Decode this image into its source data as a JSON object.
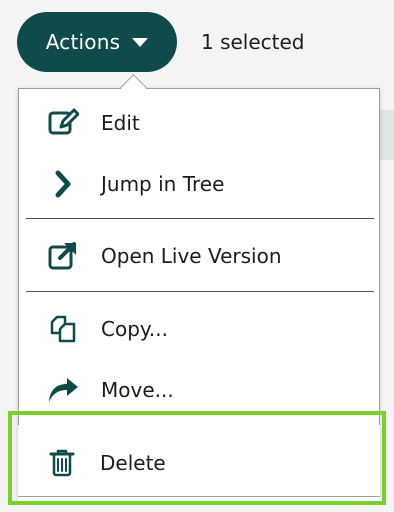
{
  "toolbar": {
    "actions_label": "Actions",
    "selection_count": "1 selected"
  },
  "menu": {
    "items": [
      {
        "label": "Edit",
        "icon": "edit-icon"
      },
      {
        "label": "Jump in Tree",
        "icon": "chevron-right-icon"
      },
      {
        "label": "Open Live Version",
        "icon": "external-link-icon"
      },
      {
        "label": "Copy...",
        "icon": "copy-icon"
      },
      {
        "label": "Move...",
        "icon": "move-icon"
      },
      {
        "label": "Delete",
        "icon": "trash-icon"
      }
    ]
  },
  "colors": {
    "primary": "#0f4b4a",
    "highlight": "#7bd12b",
    "text": "#1c1c1c"
  }
}
